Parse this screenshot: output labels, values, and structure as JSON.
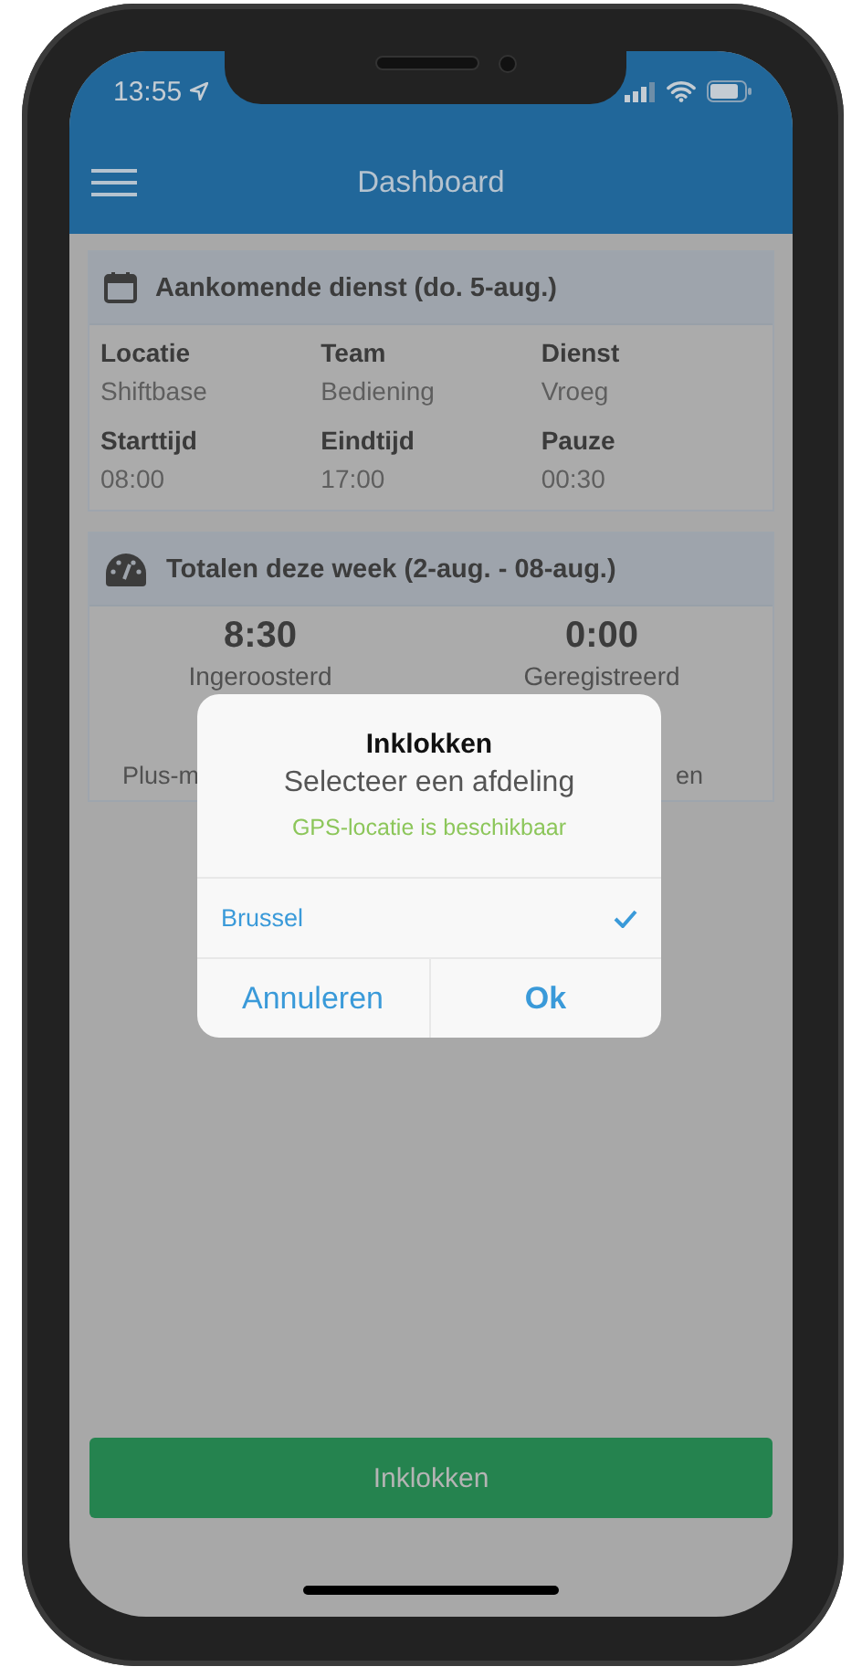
{
  "status_bar": {
    "time": "13:55"
  },
  "header": {
    "title": "Dashboard"
  },
  "cards": [
    {
      "kind": "details",
      "title": "Aankomende dienst (do. 5-aug.)",
      "fields": [
        {
          "label": "Locatie",
          "value": "Shiftbase"
        },
        {
          "label": "Team",
          "value": "Bediening"
        },
        {
          "label": "Dienst",
          "value": "Vroeg"
        },
        {
          "label": "Starttijd",
          "value": "08:00"
        },
        {
          "label": "Eindtijd",
          "value": "17:00"
        },
        {
          "label": "Pauze",
          "value": "00:30"
        }
      ]
    },
    {
      "kind": "totals",
      "title": "Totalen deze week (2-aug. - 08-aug.)",
      "totals": [
        {
          "value": "8:30",
          "label": "Ingeroosterd"
        },
        {
          "value": "0:00",
          "label": "Geregistreerd"
        }
      ],
      "footer": [
        "Plus-m",
        "en"
      ]
    }
  ],
  "dialog": {
    "title": "Inklokken",
    "message": "Selecteer een afdeling",
    "status": "GPS-locatie is beschikbaar",
    "options": [
      {
        "label": "Brussel",
        "selected": true
      }
    ],
    "buttons": [
      {
        "label": "Annuleren",
        "kind": "cancel"
      },
      {
        "label": "Ok",
        "kind": "confirm"
      }
    ]
  },
  "primary_button": {
    "label": "Inklokken"
  }
}
